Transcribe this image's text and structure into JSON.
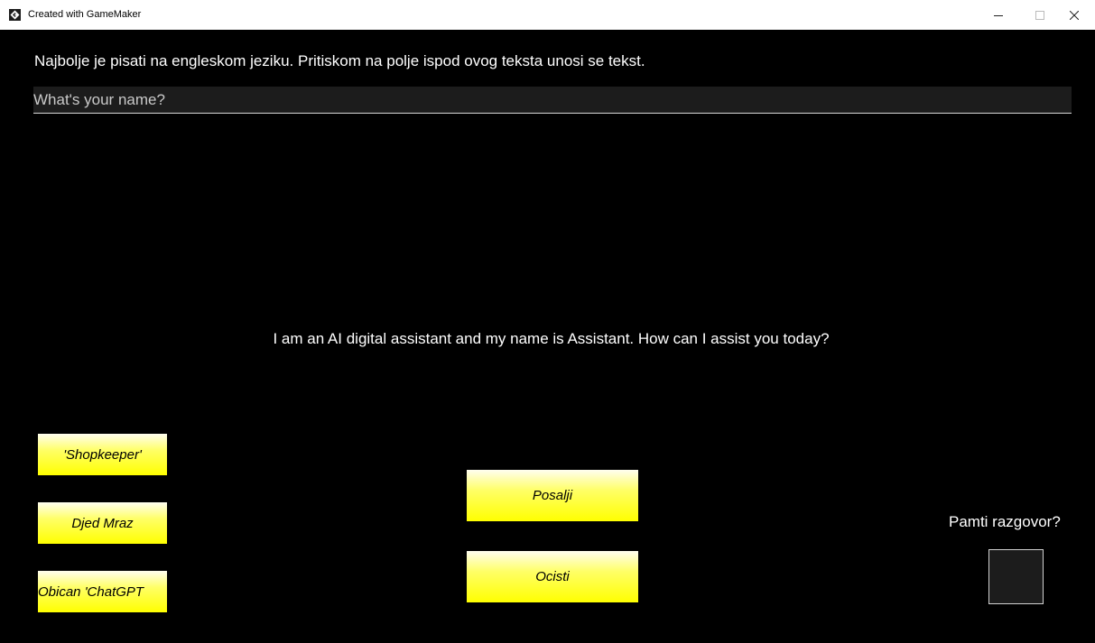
{
  "window": {
    "title": "Created with GameMaker"
  },
  "icons": {
    "app": "gamemaker-logo-icon",
    "minimize": "minimize-icon",
    "maximize": "maximize-icon",
    "close": "close-icon"
  },
  "main": {
    "instructions": "Najbolje je pisati na engleskom jeziku. Pritiskom na polje ispod ovog teksta unosi se tekst.",
    "input_value": "",
    "input_placeholder": "What's your name?",
    "assistant_reply": "I am an AI digital assistant and my name is Assistant. How can I assist you today?"
  },
  "personas": [
    {
      "label": "'Shopkeeper'"
    },
    {
      "label": "Djed Mraz"
    },
    {
      "label": "Obican 'ChatGPT"
    }
  ],
  "actions": {
    "send_label": "Posalji",
    "clear_label": "Ocisti"
  },
  "memory": {
    "label": "Pamti razgovor?",
    "checked": false
  },
  "colors": {
    "background": "#000000",
    "button_yellow": "#ffff00",
    "text": "#ffffff",
    "input_bg": "#1c1c1c"
  }
}
